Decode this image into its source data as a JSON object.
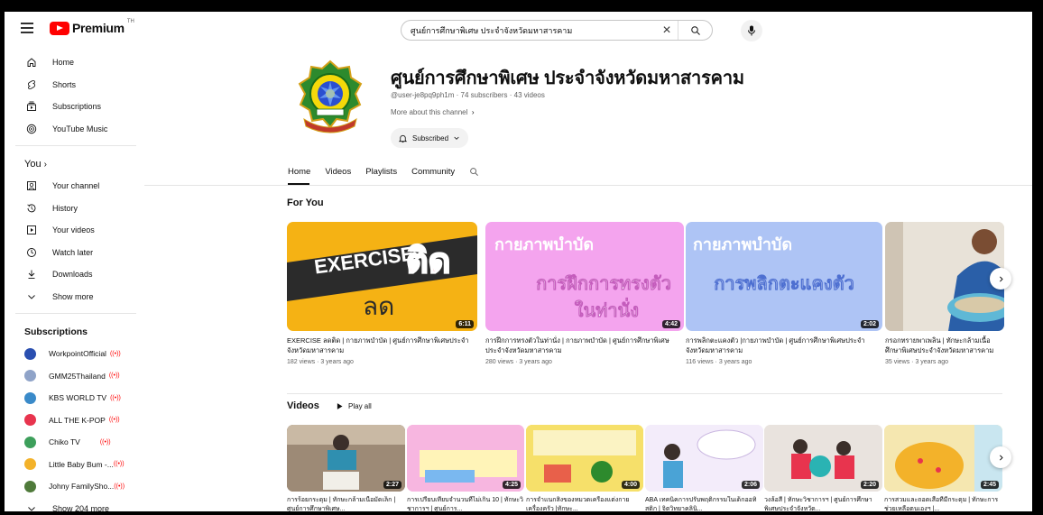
{
  "header": {
    "logo_text": "Premium",
    "country_code": "TH",
    "search_value": "ศูนย์การศึกษาพิเศษ ประจำจังหวัดมหาสารคาม"
  },
  "sidebar": {
    "main": [
      {
        "label": "Home",
        "icon": "home-icon"
      },
      {
        "label": "Shorts",
        "icon": "shorts-icon"
      },
      {
        "label": "Subscriptions",
        "icon": "subscriptions-icon"
      },
      {
        "label": "YouTube Music",
        "icon": "youtube-music-icon"
      }
    ],
    "you_label": "You",
    "you": [
      {
        "label": "Your channel",
        "icon": "your-channel-icon"
      },
      {
        "label": "History",
        "icon": "history-icon"
      },
      {
        "label": "Your videos",
        "icon": "your-videos-icon"
      },
      {
        "label": "Watch later",
        "icon": "watch-later-icon"
      },
      {
        "label": "Downloads",
        "icon": "download-icon"
      },
      {
        "label": "Show more",
        "icon": "chevron-down-icon"
      }
    ],
    "subs_title": "Subscriptions",
    "subs": [
      {
        "label": "WorkpointOfficial",
        "color": "#2a4fb0"
      },
      {
        "label": "GMM25Thailand",
        "color": "#8fa3c8"
      },
      {
        "label": "KBS WORLD TV",
        "color": "#3a8ac9"
      },
      {
        "label": "ALL THE K-POP",
        "color": "#e8344e"
      },
      {
        "label": "Chiko TV",
        "color": "#3d9f5b"
      },
      {
        "label": "Little Baby Bum -...",
        "color": "#f3b22a"
      },
      {
        "label": "Johny FamilySho...",
        "color": "#4f7a3a"
      }
    ],
    "show_more_subs": "Show 204 more"
  },
  "channel": {
    "title": "ศูนย์การศึกษาพิเศษ ประจำจังหวัดมหาสารคาม",
    "meta": "@user-je8pq9ph1m · 74 subscribers · 43 videos",
    "more": "More about this channel",
    "subscribed": "Subscribed",
    "tabs": [
      "Home",
      "Videos",
      "Playlists",
      "Community"
    ]
  },
  "for_you": {
    "title": "For You",
    "videos": [
      {
        "title": "EXERCISE ลดติด | กายภาพบำบัด | ศูนย์การศึกษาพิเศษประจำจังหวัดมหาสารคาม",
        "meta": "182 views · 3 years ago",
        "duration": "6:11",
        "thumb_big": "EXERCISE",
        "thumb_word": "ติด",
        "thumb_sub": "ลด"
      },
      {
        "title": "การฝึกการทรงตัวในท่านั่ง | กายภาพบำบัด | ศูนย์การศึกษาพิเศษประจำจังหวัดมหาสารคาม",
        "meta": "280 views · 3 years ago",
        "duration": "4:42",
        "thumb_top": "กายภาพบำบัด",
        "thumb_main": "การฝึกการทรงตัว",
        "thumb_main2": "ในท่านั่ง"
      },
      {
        "title": "การพลิกตะแคงตัว |กายภาพบำบัด | ศูนย์การศึกษาพิเศษประจำจังหวัดมหาสารคาม",
        "meta": "116 views · 3 years ago",
        "duration": "2:02",
        "thumb_top": "กายภาพบำบัด",
        "thumb_main": "การพลิกตะแคงตัว"
      },
      {
        "title": "กรอกทรายพาเพลิน | ทักษะกล้ามเนื้อศึกษาพิเศษประจำจังหวัดมหาสารคาม",
        "meta": "35 views · 3 years ago",
        "duration": ""
      }
    ]
  },
  "videos": {
    "title": "Videos",
    "play_all": "Play all",
    "items": [
      {
        "title": "การร้อยกระดุม | ทักษะกล้ามเนื้อมัดเล็ก | ศูนย์การศึกษาพิเศษ...",
        "duration": "2:27"
      },
      {
        "title": "การเปรียบเทียบจำนวนที่ไม่เกิน 10 | ทักษะวิชาการฯ | ศูนย์การ...",
        "duration": "4:25"
      },
      {
        "title": "การจำแนกสิ่งของหมวดเครื่องแต่งกาย เครื่องครัว |ทักษะ...",
        "duration": "4:00"
      },
      {
        "title": "ABA เทคนิคการปรับพฤติกรรมในเด็กออทิสติก | จิตวิทยาคลินิ...",
        "duration": "2:06"
      },
      {
        "title": "วงล้อสี | ทักษะวิชาการฯ | ศูนย์การศึกษาพิเศษประจำจังหวัด...",
        "duration": "2:20"
      },
      {
        "title": "การสวมและถอดเสื้อที่มีกระดุม | ทักษะการช่วยเหลือตนเองฯ |...",
        "duration": "2:45"
      }
    ]
  },
  "colors": {
    "brand_red": "#ff0000",
    "pink": "#f4a4ee",
    "blue": "#aec4f5",
    "yellow": "#f5b214"
  }
}
